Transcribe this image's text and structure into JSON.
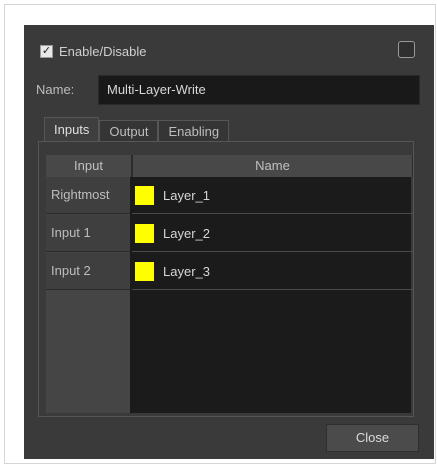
{
  "header": {
    "enable_label": "Enable/Disable",
    "enable_checked": true
  },
  "name": {
    "label": "Name:",
    "value": "Multi-Layer-Write"
  },
  "tabs": [
    {
      "label": "Inputs",
      "active": true
    },
    {
      "label": "Output",
      "active": false
    },
    {
      "label": "Enabling",
      "active": false
    }
  ],
  "table": {
    "headers": {
      "input": "Input",
      "name": "Name"
    },
    "rows": [
      {
        "input": "Rightmost",
        "name": "Layer_1",
        "color": "#ffff00"
      },
      {
        "input": "Input 1",
        "name": "Layer_2",
        "color": "#ffff00"
      },
      {
        "input": "Input 2",
        "name": "Layer_3",
        "color": "#ffff00"
      }
    ]
  },
  "footer": {
    "close_label": "Close"
  }
}
